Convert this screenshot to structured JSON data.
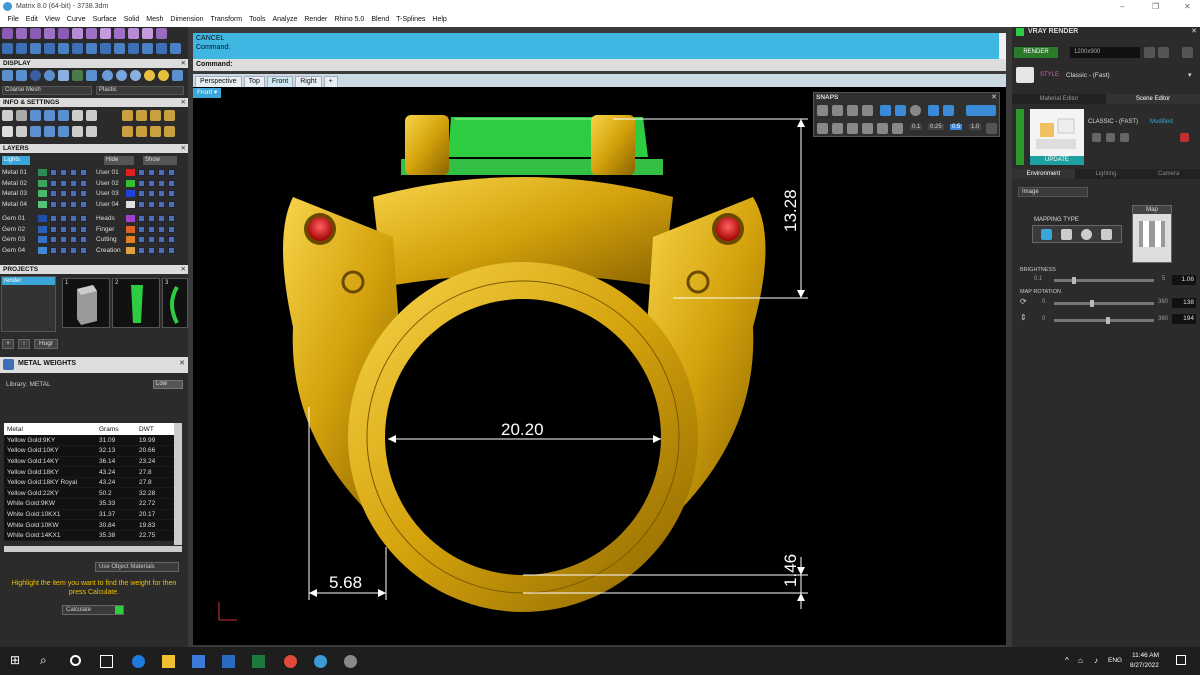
{
  "app": {
    "title": "Matrix 8.0 (64-bit) - 3738.3dm"
  },
  "menu": [
    "File",
    "Edit",
    "View",
    "Curve",
    "Surface",
    "Solid",
    "Mesh",
    "Dimension",
    "Transform",
    "Tools",
    "Analyze",
    "Render",
    "Rhino 5.0",
    "Blend",
    "T-Splines",
    "Help"
  ],
  "left": {
    "display": {
      "title": "DISPLAY",
      "mesh_select": "Coarse Mesh",
      "material_select": "Plastic"
    },
    "info_title": "INFO & SETTINGS",
    "layers": {
      "title": "LAYERS",
      "lights": "Lights",
      "hide": "Hide",
      "show": "Show",
      "col1": [
        "Metal 01",
        "Metal 02",
        "Metal 03",
        "Metal 04",
        "Gem 01",
        "Gem 02",
        "Gem 03",
        "Gem 04"
      ],
      "col2": [
        "User 01",
        "User 02",
        "User 03",
        "User 04",
        "Heads",
        "Finger",
        "Cutting",
        "Creation"
      ]
    },
    "projects": {
      "title": "PROJECTS",
      "item": "render",
      "thumbs": [
        "1",
        "2",
        "3"
      ],
      "btn_hugr": "Hugr"
    },
    "metal_weights": {
      "title": "METAL WEIGHTS",
      "library": "Library: METAL",
      "btn_low": "Low",
      "headers": [
        "Metal",
        "Grams",
        "DWT"
      ],
      "rows": [
        [
          "Yellow Gold:9KY",
          "31.09",
          "19.99"
        ],
        [
          "Yellow Gold:10KY",
          "32.13",
          "20.66"
        ],
        [
          "Yellow Gold:14KY",
          "36.14",
          "23.24"
        ],
        [
          "Yellow Gold:18KY",
          "43.24",
          "27.8"
        ],
        [
          "Yellow Gold:18KY Royal",
          "43.24",
          "27.8"
        ],
        [
          "Yellow Gold:22KY",
          "50.2",
          "32.28"
        ],
        [
          "White Gold:9KW",
          "35.33",
          "22.72"
        ],
        [
          "White Gold:10KX1",
          "31.37",
          "20.17"
        ],
        [
          "White Gold:10KW",
          "30.84",
          "19.83"
        ],
        [
          "White Gold:14KX1",
          "35.38",
          "22.75"
        ]
      ],
      "use_materials": "Use Object Materials",
      "hint": "Highlight the item you want to find the weight for then press Calculate.",
      "calculate": "Calculate"
    }
  },
  "command": {
    "line1": "CANCEL",
    "line2": "Command:",
    "prompt": "Command:"
  },
  "viewtabs": [
    "Perspective",
    "Top",
    "Front",
    "Right"
  ],
  "active_view": "Front",
  "snaps": {
    "title": "SNAPS",
    "values": [
      "0.1",
      "0.25",
      "0.5",
      "1.0"
    ]
  },
  "dimensions": {
    "height": "13.28",
    "inner": "20.20",
    "shank": "5.68",
    "bottom": "1.46"
  },
  "right": {
    "title": "VRAY RENDER",
    "render_btn": "RENDER",
    "resolution": "1200x900",
    "style_label": "STYLE",
    "style_value": "Classic - (Fast)",
    "tabs": [
      "Material Editor",
      "Scene Editor"
    ],
    "preset_name": "CLASSIC - (FAST)",
    "preset_state": "Modified",
    "update": "UPDATE",
    "env_tabs": [
      "Environment",
      "Lighting",
      "Camera"
    ],
    "env_select": "Image",
    "mapping_type": "MAPPING TYPE",
    "map_label": "Map",
    "brightness": {
      "label": "BRIGHTNESS",
      "min": "0.1",
      "max": "5",
      "value": "1.06",
      "fraction": 0.2
    },
    "map_rotation": {
      "label": "MAP ROTATION",
      "r1": {
        "min": "0",
        "max": "360",
        "value": "138",
        "fraction": 0.38
      },
      "r2": {
        "min": "0",
        "max": "360",
        "value": "194",
        "fraction": 0.54
      }
    }
  },
  "taskbar": {
    "lang": "ENG",
    "time": "11:46 AM",
    "date": "8/27/2022"
  }
}
